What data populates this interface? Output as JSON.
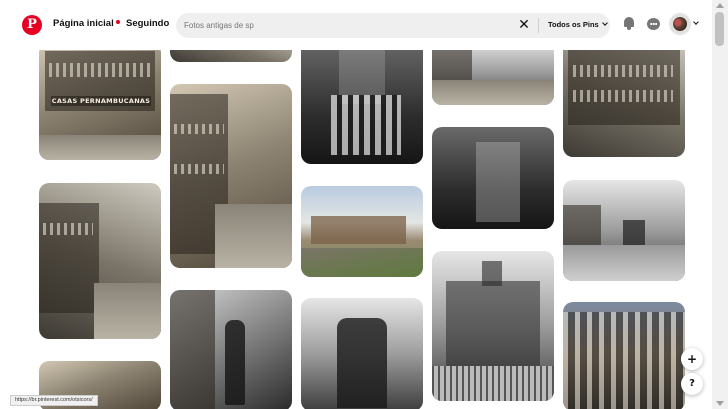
{
  "header": {
    "logo_icon": "pinterest-logo-icon",
    "logo_glyph": "P",
    "nav_home": "Página inicial",
    "nav_following": "Seguindo",
    "search_value": "Fotos antigas de sp",
    "clear_glyph": "✕",
    "filter_label": "Todos os Pins",
    "icons": [
      "bell-icon",
      "chat-icon",
      "avatar",
      "chevron-down-icon"
    ]
  },
  "pins": [
    {
      "label": "CASAS PERNAMBUCANAS",
      "icon": "photo"
    }
  ],
  "fab": {
    "plus": "+",
    "help": "?"
  },
  "status": {
    "url": "https://br.pinterest.com/otsicors/"
  },
  "colors": {
    "brand": "#e60023",
    "search_bg": "#efefef",
    "text": "#111111"
  }
}
